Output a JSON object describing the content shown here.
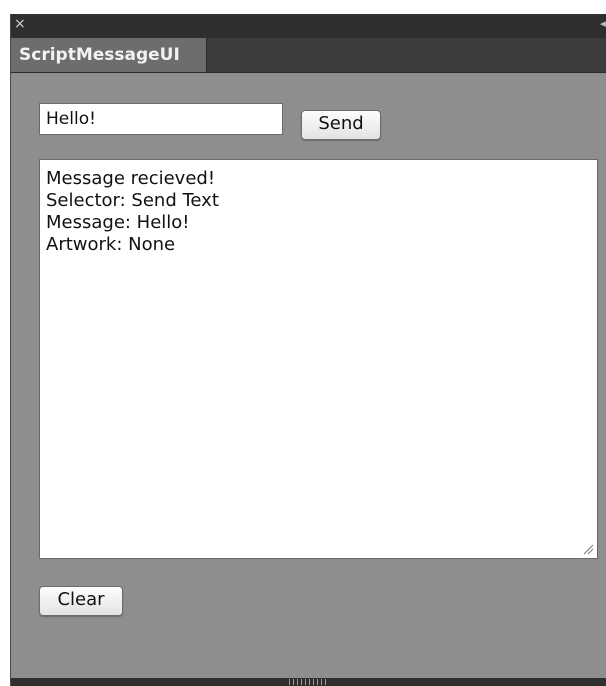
{
  "panel": {
    "close_glyph": "×",
    "collapse_glyph": "◂◂",
    "tab_title": "ScriptMessageUI"
  },
  "form": {
    "input_value": "Hello!",
    "send_label": "Send",
    "clear_label": "Clear"
  },
  "output": {
    "lines": [
      "Message recieved!",
      "Selector: Send Text",
      "Message: Hello!",
      "Artwork: None"
    ]
  },
  "colors": {
    "panel_bg": "#8e8e8e",
    "titlebar_bg": "#2f2f2f",
    "tab_bg": "#6d6d6d"
  },
  "icons": {
    "close": "close-icon",
    "collapse": "collapse-double-arrow-icon",
    "resize": "resize-grip-icon"
  }
}
